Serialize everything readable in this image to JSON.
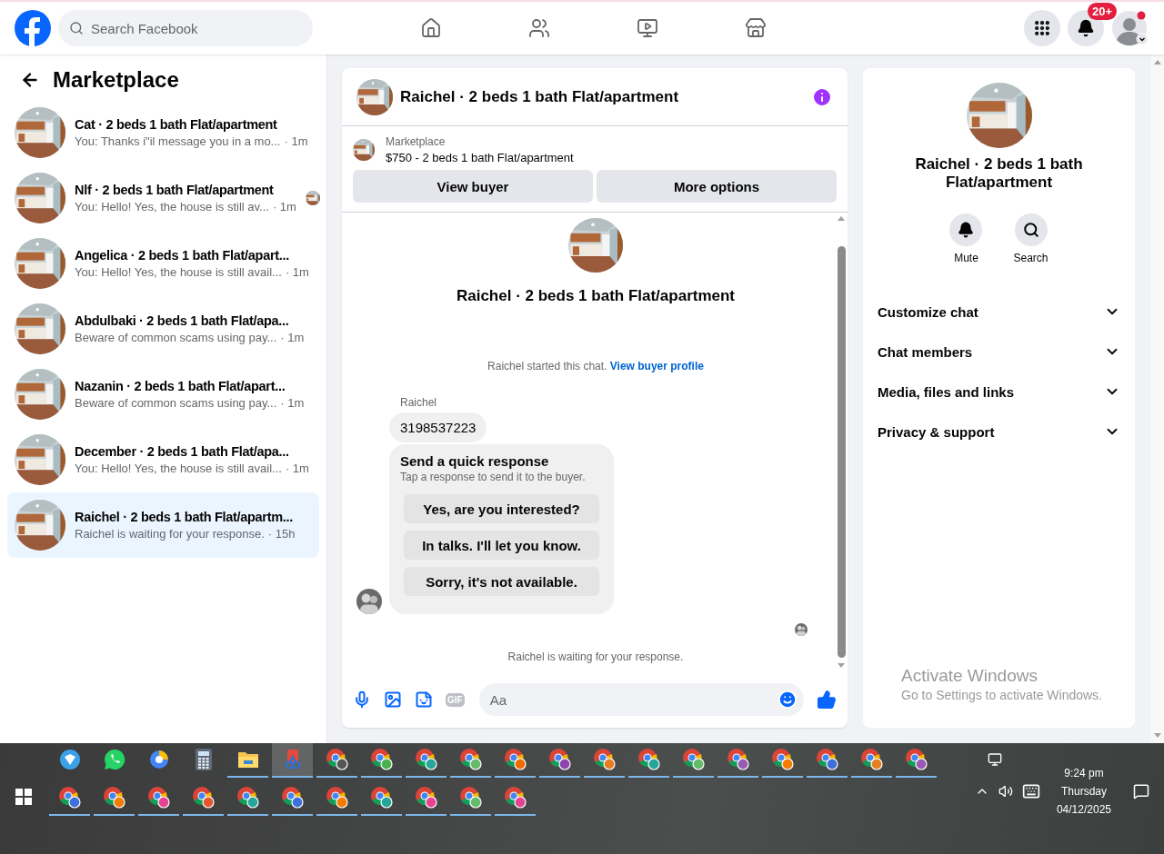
{
  "top_nav": {
    "search": {
      "placeholder": "Search Facebook"
    },
    "notification_badge": "20+"
  },
  "sidebar": {
    "title": "Marketplace",
    "conversations": [
      {
        "title": "Cat · 2 beds 1 bath Flat/apartment",
        "preview": "You: Thanks i\"il message you in a mo...",
        "time": "· 1m",
        "seen": false,
        "selected": false
      },
      {
        "title": "Nlf · 2 beds 1 bath Flat/apartment",
        "preview": "You: Hello! Yes, the house is still av...",
        "time": "· 1m",
        "seen": true,
        "selected": false
      },
      {
        "title": "Angelica · 2 beds 1 bath Flat/apart...",
        "preview": "You: Hello! Yes, the house is still avail...",
        "time": "· 1m",
        "seen": false,
        "selected": false
      },
      {
        "title": "Abdulbaki · 2 beds 1 bath Flat/apa...",
        "preview": "Beware of common scams using pay...",
        "time": "· 1m",
        "seen": false,
        "selected": false
      },
      {
        "title": "Nazanin · 2 beds 1 bath Flat/apart...",
        "preview": "Beware of common scams using pay...",
        "time": "· 1m",
        "seen": false,
        "selected": false
      },
      {
        "title": "December · 2 beds 1 bath Flat/apa...",
        "preview": "You: Hello! Yes, the house is still avail...",
        "time": "· 1m",
        "seen": false,
        "selected": false
      },
      {
        "title": "Raichel · 2 beds 1 bath Flat/apartm...",
        "preview": "Raichel is waiting for your response.",
        "time": "· 15h",
        "seen": false,
        "selected": true
      }
    ]
  },
  "chat": {
    "title": "Raichel · 2 beds 1 bath Flat/apartment",
    "listing": {
      "source": "Marketplace",
      "summary": "$750 - 2 beds 1 bath Flat/apartment"
    },
    "listing_buttons": [
      "View buyer",
      "More options"
    ],
    "intro_title": "Raichel · 2 beds 1 bath Flat/apartment",
    "started_text": "Raichel started this chat.",
    "started_link": "View buyer profile",
    "sender": "Raichel",
    "message": "3198537223",
    "quick_response": {
      "title": "Send a quick response",
      "subtitle": "Tap a response to send it to the buyer.",
      "options": [
        "Yes, are you interested?",
        "In talks. I'll let you know.",
        "Sorry, it's not available."
      ]
    },
    "waiting_text": "Raichel is waiting for your response.",
    "composer": {
      "gif_label": "GIF",
      "placeholder": "Aa"
    }
  },
  "details_panel": {
    "title": "Raichel · 2 beds 1 bath Flat/apartment",
    "actions": [
      {
        "kind": "mute",
        "label": "Mute"
      },
      {
        "kind": "search",
        "label": "Search"
      }
    ],
    "sections": [
      {
        "label": "Customize chat",
        "expanded": false
      },
      {
        "label": "Chat members",
        "expanded": false
      },
      {
        "label": "Media, files and links",
        "expanded": false
      },
      {
        "label": "Privacy & support",
        "expanded": false
      }
    ]
  },
  "activation_notice": {
    "title": "Activate Windows",
    "subtitle": "Go to Settings to activate Windows."
  },
  "taskbar": {
    "apps": [
      {
        "kind": "shield",
        "running": false,
        "active": false
      },
      {
        "kind": "whatsapp",
        "running": false,
        "active": false
      },
      {
        "kind": "browser",
        "running": false,
        "active": false
      },
      {
        "kind": "calculator",
        "running": false,
        "active": false
      },
      {
        "kind": "folder",
        "running": true,
        "active": false
      },
      {
        "kind": "snip",
        "running": true,
        "active": true
      },
      {
        "kind": "chrome",
        "color": "#555555",
        "running": true,
        "active": false
      },
      {
        "kind": "chrome",
        "color": "#4caf50",
        "running": true,
        "active": false
      },
      {
        "kind": "chrome",
        "color": "#26a69a",
        "running": true,
        "active": false
      },
      {
        "kind": "chrome",
        "color": "#66bb6a",
        "running": true,
        "active": false
      },
      {
        "kind": "chrome",
        "color": "#ef6c00",
        "running": true,
        "active": false
      },
      {
        "kind": "chrome",
        "color": "#8e44ad",
        "running": true,
        "active": false
      },
      {
        "kind": "chrome",
        "color": "#e67e22",
        "running": true,
        "active": false
      },
      {
        "kind": "chrome",
        "color": "#26a69a",
        "running": true,
        "active": false
      },
      {
        "kind": "chrome",
        "color": "#66bb6a",
        "running": true,
        "active": false
      },
      {
        "kind": "chrome",
        "color": "#9b59b6",
        "running": true,
        "active": false
      },
      {
        "kind": "chrome",
        "color": "#f57c00",
        "running": true,
        "active": false
      },
      {
        "kind": "chrome",
        "color": "#3f6fd8",
        "running": true,
        "active": false
      },
      {
        "kind": "chrome",
        "color": "#e67e22",
        "running": true,
        "active": false
      },
      {
        "kind": "chrome",
        "color": "#9b59b6",
        "running": true,
        "active": false
      },
      {
        "kind": "chrome",
        "color": "#3f6fd8",
        "running": true,
        "active": false
      },
      {
        "kind": "chrome",
        "color": "#f57c00",
        "running": true,
        "active": false
      },
      {
        "kind": "chrome",
        "color": "#e84393",
        "running": true,
        "active": false
      },
      {
        "kind": "chrome",
        "color": "#e4572e",
        "running": true,
        "active": false
      },
      {
        "kind": "chrome",
        "color": "#26a69a",
        "running": true,
        "active": false
      },
      {
        "kind": "chrome",
        "color": "#3f6fd8",
        "running": true,
        "active": false
      },
      {
        "kind": "chrome",
        "color": "#f57c00",
        "running": true,
        "active": false
      },
      {
        "kind": "chrome",
        "color": "#26a69a",
        "running": true,
        "active": false
      },
      {
        "kind": "chrome",
        "color": "#e84393",
        "running": true,
        "active": false
      },
      {
        "kind": "chrome",
        "color": "#66bb6a",
        "running": true,
        "active": false
      },
      {
        "kind": "chrome",
        "color": "#e84393",
        "running": true,
        "active": false
      }
    ],
    "clock": {
      "time": "9:24 pm",
      "day": "Thursday",
      "date": "04/12/2025"
    }
  }
}
